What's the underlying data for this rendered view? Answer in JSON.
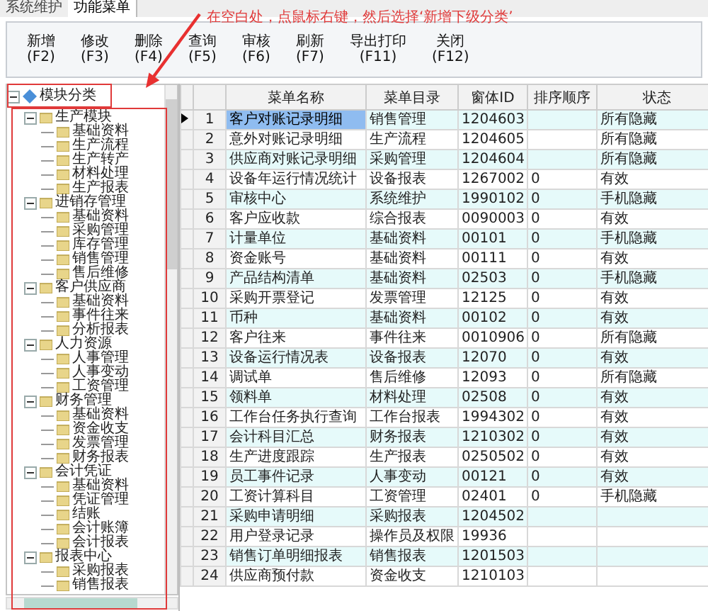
{
  "tabs": [
    {
      "label": "系统维护",
      "selected": false
    },
    {
      "label": "功能菜单",
      "selected": true
    }
  ],
  "annotation": {
    "text": "在空白处，点鼠标右键，然后选择‘新增下级分类’"
  },
  "toolbar": [
    {
      "label": "新增",
      "key": "(F2)"
    },
    {
      "label": "修改",
      "key": "(F3)"
    },
    {
      "label": "删除",
      "key": "(F4)"
    },
    {
      "label": "查询",
      "key": "(F5)"
    },
    {
      "label": "审核",
      "key": "(F6)"
    },
    {
      "label": "刷新",
      "key": "(F7)"
    },
    {
      "label": "导出打印",
      "key": "(F11)"
    },
    {
      "label": "关闭",
      "key": "(F12)"
    }
  ],
  "tree": {
    "label": "模块分类",
    "expanded": true,
    "children": [
      {
        "label": "生产模块",
        "expanded": true,
        "children": [
          {
            "label": "基础资料"
          },
          {
            "label": "生产流程"
          },
          {
            "label": "生产转产"
          },
          {
            "label": "材料处理"
          },
          {
            "label": "生产报表"
          }
        ]
      },
      {
        "label": "进销存管理",
        "expanded": true,
        "children": [
          {
            "label": "基础资料"
          },
          {
            "label": "采购管理"
          },
          {
            "label": "库存管理"
          },
          {
            "label": "销售管理"
          },
          {
            "label": "售后维修"
          }
        ]
      },
      {
        "label": "客户供应商",
        "expanded": true,
        "children": [
          {
            "label": "基础资料"
          },
          {
            "label": "事件往来"
          },
          {
            "label": "分析报表"
          }
        ]
      },
      {
        "label": "人力资源",
        "expanded": true,
        "children": [
          {
            "label": "人事管理"
          },
          {
            "label": "人事变动"
          },
          {
            "label": "工资管理"
          }
        ]
      },
      {
        "label": "财务管理",
        "expanded": true,
        "children": [
          {
            "label": "基础资料"
          },
          {
            "label": "资金收支"
          },
          {
            "label": "发票管理"
          },
          {
            "label": "财务报表"
          }
        ]
      },
      {
        "label": "会计凭证",
        "expanded": true,
        "children": [
          {
            "label": "基础资料"
          },
          {
            "label": "凭证管理"
          },
          {
            "label": "结账"
          },
          {
            "label": "会计账簿"
          },
          {
            "label": "会计报表"
          }
        ]
      },
      {
        "label": "报表中心",
        "expanded": true,
        "children": [
          {
            "label": "采购报表"
          },
          {
            "label": "销售报表"
          }
        ]
      }
    ]
  },
  "table": {
    "columns": [
      "菜单名称",
      "菜单目录",
      "窗体ID",
      "排序顺序",
      "状态"
    ],
    "rows": [
      {
        "num": "1",
        "cells": [
          "客户对账记录明细",
          "销售管理",
          "1204603",
          "",
          "所有隐藏"
        ],
        "selected": true
      },
      {
        "num": "2",
        "cells": [
          "意外对账记录明细",
          "生产流程",
          "1204605",
          "",
          "所有隐藏"
        ],
        "selected": false
      },
      {
        "num": "3",
        "cells": [
          "供应商对账记录明细",
          "采购管理",
          "1204604",
          "",
          "所有隐藏"
        ],
        "selected": false
      },
      {
        "num": "4",
        "cells": [
          "设备年运行情况统计",
          "设备报表",
          "1267002",
          "0",
          "有效"
        ],
        "selected": false
      },
      {
        "num": "5",
        "cells": [
          "审核中心",
          "系统维护",
          "1990102",
          "0",
          "手机隐藏"
        ],
        "selected": false
      },
      {
        "num": "6",
        "cells": [
          "客户应收款",
          "综合报表",
          "0090003",
          "0",
          "有效"
        ],
        "selected": false
      },
      {
        "num": "7",
        "cells": [
          "计量单位",
          "基础资料",
          "00101",
          "0",
          "手机隐藏"
        ],
        "selected": false
      },
      {
        "num": "8",
        "cells": [
          "资金账号",
          "基础资料",
          "00111",
          "0",
          "有效"
        ],
        "selected": false
      },
      {
        "num": "9",
        "cells": [
          "产品结构清单",
          "基础资料",
          "02503",
          "0",
          "手机隐藏"
        ],
        "selected": false
      },
      {
        "num": "10",
        "cells": [
          "采购开票登记",
          "发票管理",
          "12125",
          "0",
          "有效"
        ],
        "selected": false
      },
      {
        "num": "11",
        "cells": [
          "币种",
          "基础资料",
          "00102",
          "0",
          "有效"
        ],
        "selected": false
      },
      {
        "num": "12",
        "cells": [
          "客户往来",
          "事件往来",
          "0010906",
          "0",
          "所有隐藏"
        ],
        "selected": false
      },
      {
        "num": "13",
        "cells": [
          "设备运行情况表",
          "设备报表",
          "12070",
          "0",
          "有效"
        ],
        "selected": false
      },
      {
        "num": "14",
        "cells": [
          "调试单",
          "售后维修",
          "12093",
          "0",
          "所有隐藏"
        ],
        "selected": false
      },
      {
        "num": "15",
        "cells": [
          "领料单",
          "材料处理",
          "02508",
          "0",
          "有效"
        ],
        "selected": false
      },
      {
        "num": "16",
        "cells": [
          "工作台任务执行查询",
          "工作台报表",
          "1994302",
          "0",
          "有效"
        ],
        "selected": false
      },
      {
        "num": "17",
        "cells": [
          "会计科目汇总",
          "财务报表",
          "1210302",
          "0",
          "有效"
        ],
        "selected": false
      },
      {
        "num": "18",
        "cells": [
          "生产进度跟踪",
          "生产报表",
          "0250502",
          "0",
          "有效"
        ],
        "selected": false
      },
      {
        "num": "19",
        "cells": [
          "员工事件记录",
          "人事变动",
          "00121",
          "0",
          "有效"
        ],
        "selected": false
      },
      {
        "num": "20",
        "cells": [
          "工资计算科目",
          "工资管理",
          "02401",
          "0",
          "手机隐藏"
        ],
        "selected": false
      },
      {
        "num": "21",
        "cells": [
          "采购申请明细",
          "采购报表",
          "1204502"
        ],
        "selected": false
      },
      {
        "num": "22",
        "cells": [
          "用户登录记录",
          "操作员及权限",
          "19936"
        ],
        "selected": false
      },
      {
        "num": "23",
        "cells": [
          "销售订单明细报表",
          "销售报表",
          "1201503"
        ],
        "selected": false
      },
      {
        "num": "24",
        "cells": [
          "供应商预付款",
          "资金收支",
          "1210103"
        ],
        "selected": false
      }
    ]
  }
}
